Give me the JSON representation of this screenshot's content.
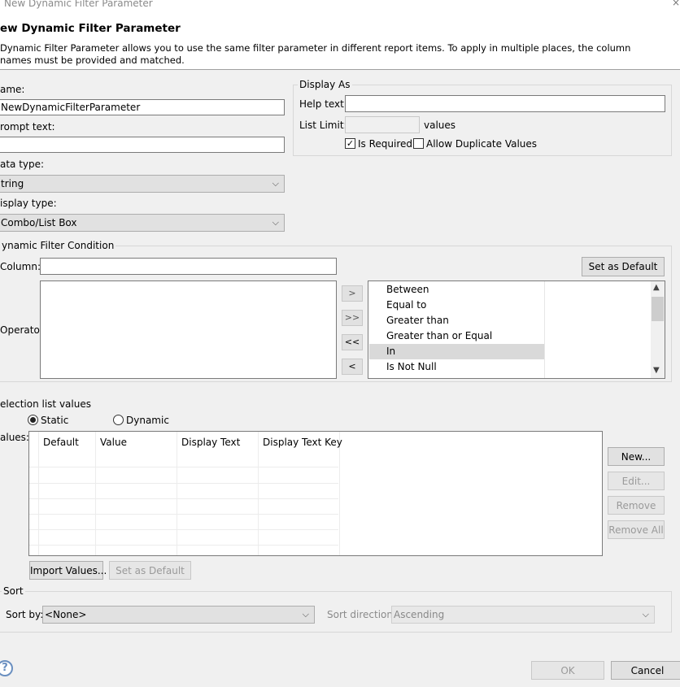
{
  "window": {
    "title": "New Dynamic Filter Parameter",
    "close": "×"
  },
  "header": {
    "title": "ew Dynamic Filter Parameter",
    "description": " Dynamic Filter Parameter allows you to use the same filter parameter in different report items. To apply in multiple places, the column names must be provided and matched."
  },
  "form": {
    "name_label": "ame:",
    "name_value": "NewDynamicFilterParameter",
    "prompt_label": "rompt text:",
    "prompt_value": "",
    "data_type_label": "ata type:",
    "data_type_value": "tring",
    "display_type_label": "isplay type:",
    "display_type_value": "Combo/List Box"
  },
  "display_as": {
    "title": "Display As",
    "help_label": "Help text:",
    "help_value": "",
    "list_limit_label": "List Limit:",
    "list_limit_value": "",
    "values_suffix": "values",
    "is_required_label": "Is Required",
    "is_required_checked": true,
    "allow_dup_label": "Allow Duplicate Values",
    "allow_dup_checked": false
  },
  "condition": {
    "title": "ynamic Filter Condition",
    "column_label": "Column:",
    "column_value": "",
    "set_default_label": "Set as Default",
    "operator_label": "Operator:",
    "move_buttons": [
      ">",
      ">>",
      "<<",
      "<"
    ],
    "operators": [
      "Between",
      "Equal to",
      "Greater than",
      "Greater than or Equal",
      "In",
      "Is Not Null"
    ],
    "selected_operator": "In"
  },
  "selection": {
    "title": "election list values",
    "static_label": "Static",
    "dynamic_label": "Dynamic",
    "selected_mode": "Static",
    "values_label": "alues:",
    "columns": [
      "Default",
      "Value",
      "Display Text",
      "Display Text Key"
    ],
    "buttons": {
      "new": "New...",
      "edit": "Edit...",
      "remove": "Remove",
      "remove_all": "Remove All"
    },
    "import_label": "Import Values...",
    "set_default_label": "Set as Default"
  },
  "sort": {
    "title": "Sort",
    "sort_by_label": "Sort by:",
    "sort_by_value": "<None>",
    "direction_label": "Sort direction:",
    "direction_value": "Ascending"
  },
  "footer": {
    "help": "?",
    "ok": "OK",
    "cancel": "Cancel"
  }
}
